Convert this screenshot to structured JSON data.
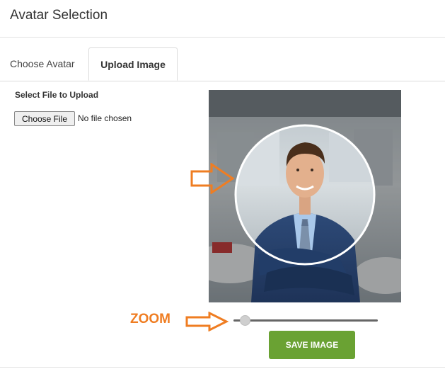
{
  "header": {
    "title": "Avatar Selection"
  },
  "tabs": [
    {
      "label": "Choose Avatar",
      "active": false
    },
    {
      "label": "Upload Image",
      "active": true
    }
  ],
  "upload": {
    "section_label": "Select File to Upload",
    "file_button_label": "Choose File",
    "file_status": "No file chosen"
  },
  "zoom": {
    "label": "ZOOM",
    "value_fraction": 0.05
  },
  "save_button_label": "SAVE IMAGE",
  "colors": {
    "accent_orange": "#ef7d22",
    "save_green": "#6aa233"
  },
  "icons": {
    "pointer_arrow": "arrow-right-outline-icon"
  }
}
